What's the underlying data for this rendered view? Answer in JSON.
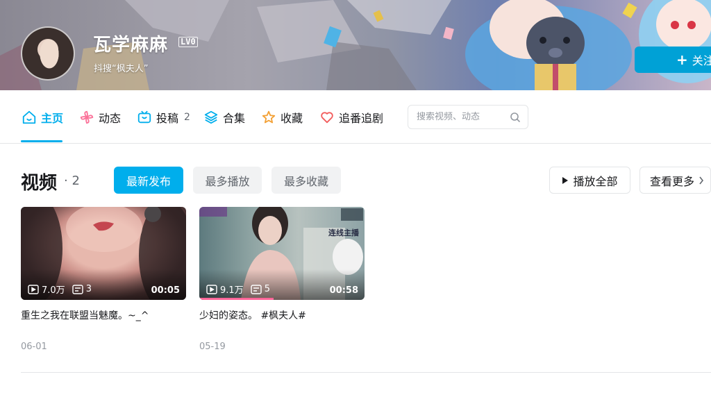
{
  "profile": {
    "name": "瓦学麻麻",
    "level": "LV0",
    "sign": "抖搜“枫夫人”",
    "follow_label": "关注"
  },
  "nav": {
    "items": [
      {
        "label": "主页",
        "icon": "home-icon",
        "active": true
      },
      {
        "label": "动态",
        "icon": "pinwheel-icon"
      },
      {
        "label": "投稿",
        "icon": "tv-icon",
        "count": "2"
      },
      {
        "label": "合集",
        "icon": "layers-icon"
      },
      {
        "label": "收藏",
        "icon": "star-icon"
      },
      {
        "label": "追番追剧",
        "icon": "heart-icon"
      }
    ],
    "search_placeholder": "搜索视频、动态"
  },
  "section": {
    "title": "视频",
    "count_text": "· 2",
    "sort_tabs": [
      "最新发布",
      "最多播放",
      "最多收藏"
    ],
    "play_all_label": "播放全部",
    "view_more_label": "查看更多"
  },
  "videos": [
    {
      "title": "重生之我在联盟当魅魔。~_^",
      "plays": "7.0万",
      "comments": "3",
      "duration": "00:05",
      "date": "06-01",
      "progress": 0
    },
    {
      "title": "少妇的姿态。 #枫夫人#",
      "plays": "9.1万",
      "comments": "5",
      "duration": "00:58",
      "date": "05-19",
      "progress": 0.45,
      "overlay_text": "连线主播"
    }
  ],
  "colors": {
    "accent": "#00aeec",
    "follow": "#00a1d6",
    "progress": "#ff6699"
  }
}
